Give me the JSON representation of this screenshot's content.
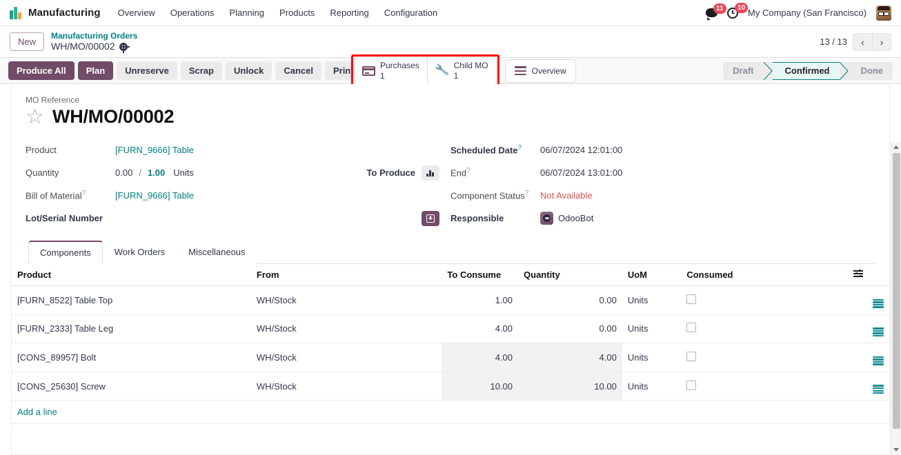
{
  "navbar": {
    "brand": "Manufacturing",
    "menu": [
      "Overview",
      "Operations",
      "Planning",
      "Products",
      "Reporting",
      "Configuration"
    ],
    "messages_count": "11",
    "activities_count": "10",
    "company": "My Company (San Francisco)"
  },
  "control_panel": {
    "new_label": "New",
    "breadcrumb_parent": "Manufacturing Orders",
    "breadcrumb_current": "WH/MO/00002",
    "smart_buttons": [
      {
        "label": "Purchases",
        "value": "1",
        "icon": "credit-card-icon"
      },
      {
        "label": "Child MO",
        "value": "1",
        "icon": "wrench-icon"
      }
    ],
    "overview_button": {
      "label": "Overview",
      "icon": "list-lines-icon"
    },
    "pager": {
      "text": "13 / 13",
      "prev": "‹",
      "next": "›"
    },
    "highlight_color": "#ff0000"
  },
  "actions": {
    "buttons": [
      {
        "label": "Produce All",
        "style": "primary"
      },
      {
        "label": "Plan",
        "style": "primary"
      },
      {
        "label": "Unreserve",
        "style": "secondary"
      },
      {
        "label": "Scrap",
        "style": "secondary"
      },
      {
        "label": "Unlock",
        "style": "secondary"
      },
      {
        "label": "Cancel",
        "style": "secondary"
      },
      {
        "label": "Print Labels",
        "style": "secondary"
      }
    ],
    "statusbar": [
      "Draft",
      "Confirmed",
      "Done"
    ],
    "status_active": "Confirmed",
    "status_active_color": "#017e84"
  },
  "form": {
    "mo_reference_label": "MO Reference",
    "title": "WH/MO/00002",
    "left": {
      "product_label": "Product",
      "product_value": "[FURN_9666] Table",
      "quantity_label": "Quantity",
      "quantity_done": "0.00",
      "quantity_sep": "/",
      "quantity_total": "1.00",
      "quantity_uom": "Units",
      "to_produce_label": "To Produce",
      "bom_label": "Bill of Material",
      "bom_value": "[FURN_9666] Table",
      "lot_serial_label": "Lot/Serial Number"
    },
    "right": {
      "scheduled_date_label": "Scheduled Date",
      "scheduled_date_value": "06/07/2024 12:01:00",
      "end_label": "End",
      "end_value": "06/07/2024 13:01:00",
      "component_status_label": "Component Status",
      "component_status_value": "Not Available",
      "component_status_color": "#d9534f",
      "responsible_label": "Responsible",
      "responsible_value": "OdooBot"
    }
  },
  "notebook": {
    "tabs": [
      "Components",
      "Work Orders",
      "Miscellaneous"
    ],
    "active_tab": "Components",
    "columns": [
      "Product",
      "From",
      "To Consume",
      "Quantity",
      "UoM",
      "Consumed"
    ],
    "rows": [
      {
        "product": "[FURN_8522] Table Top",
        "from": "WH/Stock",
        "to_consume": "1.00",
        "quantity": "0.00",
        "uom": "Units",
        "consumed": false,
        "qty_highlight": false
      },
      {
        "product": "[FURN_2333] Table Leg",
        "from": "WH/Stock",
        "to_consume": "4.00",
        "quantity": "0.00",
        "uom": "Units",
        "consumed": false,
        "qty_highlight": false
      },
      {
        "product": "[CONS_89957] Bolt",
        "from": "WH/Stock",
        "to_consume": "4.00",
        "quantity": "4.00",
        "uom": "Units",
        "consumed": false,
        "qty_highlight": true
      },
      {
        "product": "[CONS_25630] Screw",
        "from": "WH/Stock",
        "to_consume": "10.00",
        "quantity": "10.00",
        "uom": "Units",
        "consumed": false,
        "qty_highlight": true
      }
    ],
    "add_line_label": "Add a line",
    "quantity_color": "#0d9488"
  }
}
